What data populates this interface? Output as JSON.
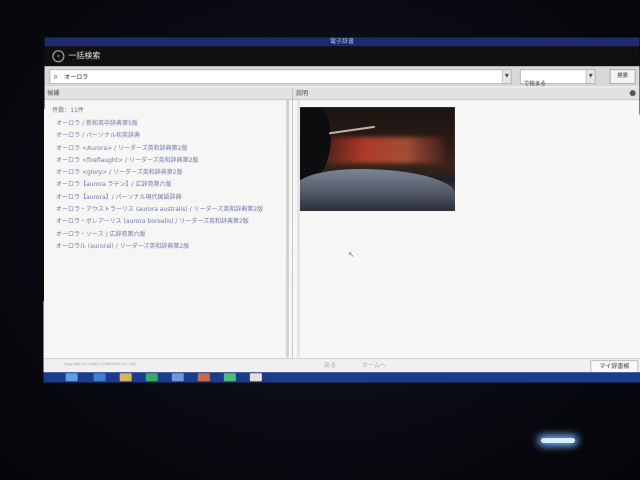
{
  "window_title": "電子辞書",
  "app_title": "一括検索",
  "search": {
    "value": "オーロラ",
    "mode": "で始まる",
    "button_label": "検索"
  },
  "left_pane": {
    "header": "候補",
    "count_text": "件数：11件",
    "results": [
      "オーロラ / 新和英中辞典第5版",
      "オーロラ / パーソナル和英辞典",
      "オーロラ <Aurora> / リーダーズ英和辞典第2版",
      "オーロラ <fireflaught> / リーダーズ英和辞典第2版",
      "オーロラ <glory> / リーダーズ英和辞典第2版",
      "オーロラ【aurora ラテン】/ 広辞苑第六版",
      "オーロラ【aurora】/ パーソナル現代国語辞典",
      "オーロラ・アウストラーリス (aurora australis) / リーダーズ英和辞典第2版",
      "オーロラ・ボレアーリス (aurora borealis) / リーダーズ英和辞典第2版",
      "オーロラ・ソース / 広辞苑第六版",
      "オーロラル (auroral) / リーダーズ英和辞典第2版"
    ]
  },
  "right_pane": {
    "header": "説明"
  },
  "bottom": {
    "copyright": "Copyright (C) CASIO COMPUTER CO., LTD.",
    "back_label": "戻る",
    "home_label": "ホームへ",
    "my_dict_label": "マイ辞書帳"
  },
  "colors": {
    "result_link": "#7078a8",
    "taskbar": "#1b3b8c",
    "header_bg": "#101010"
  }
}
